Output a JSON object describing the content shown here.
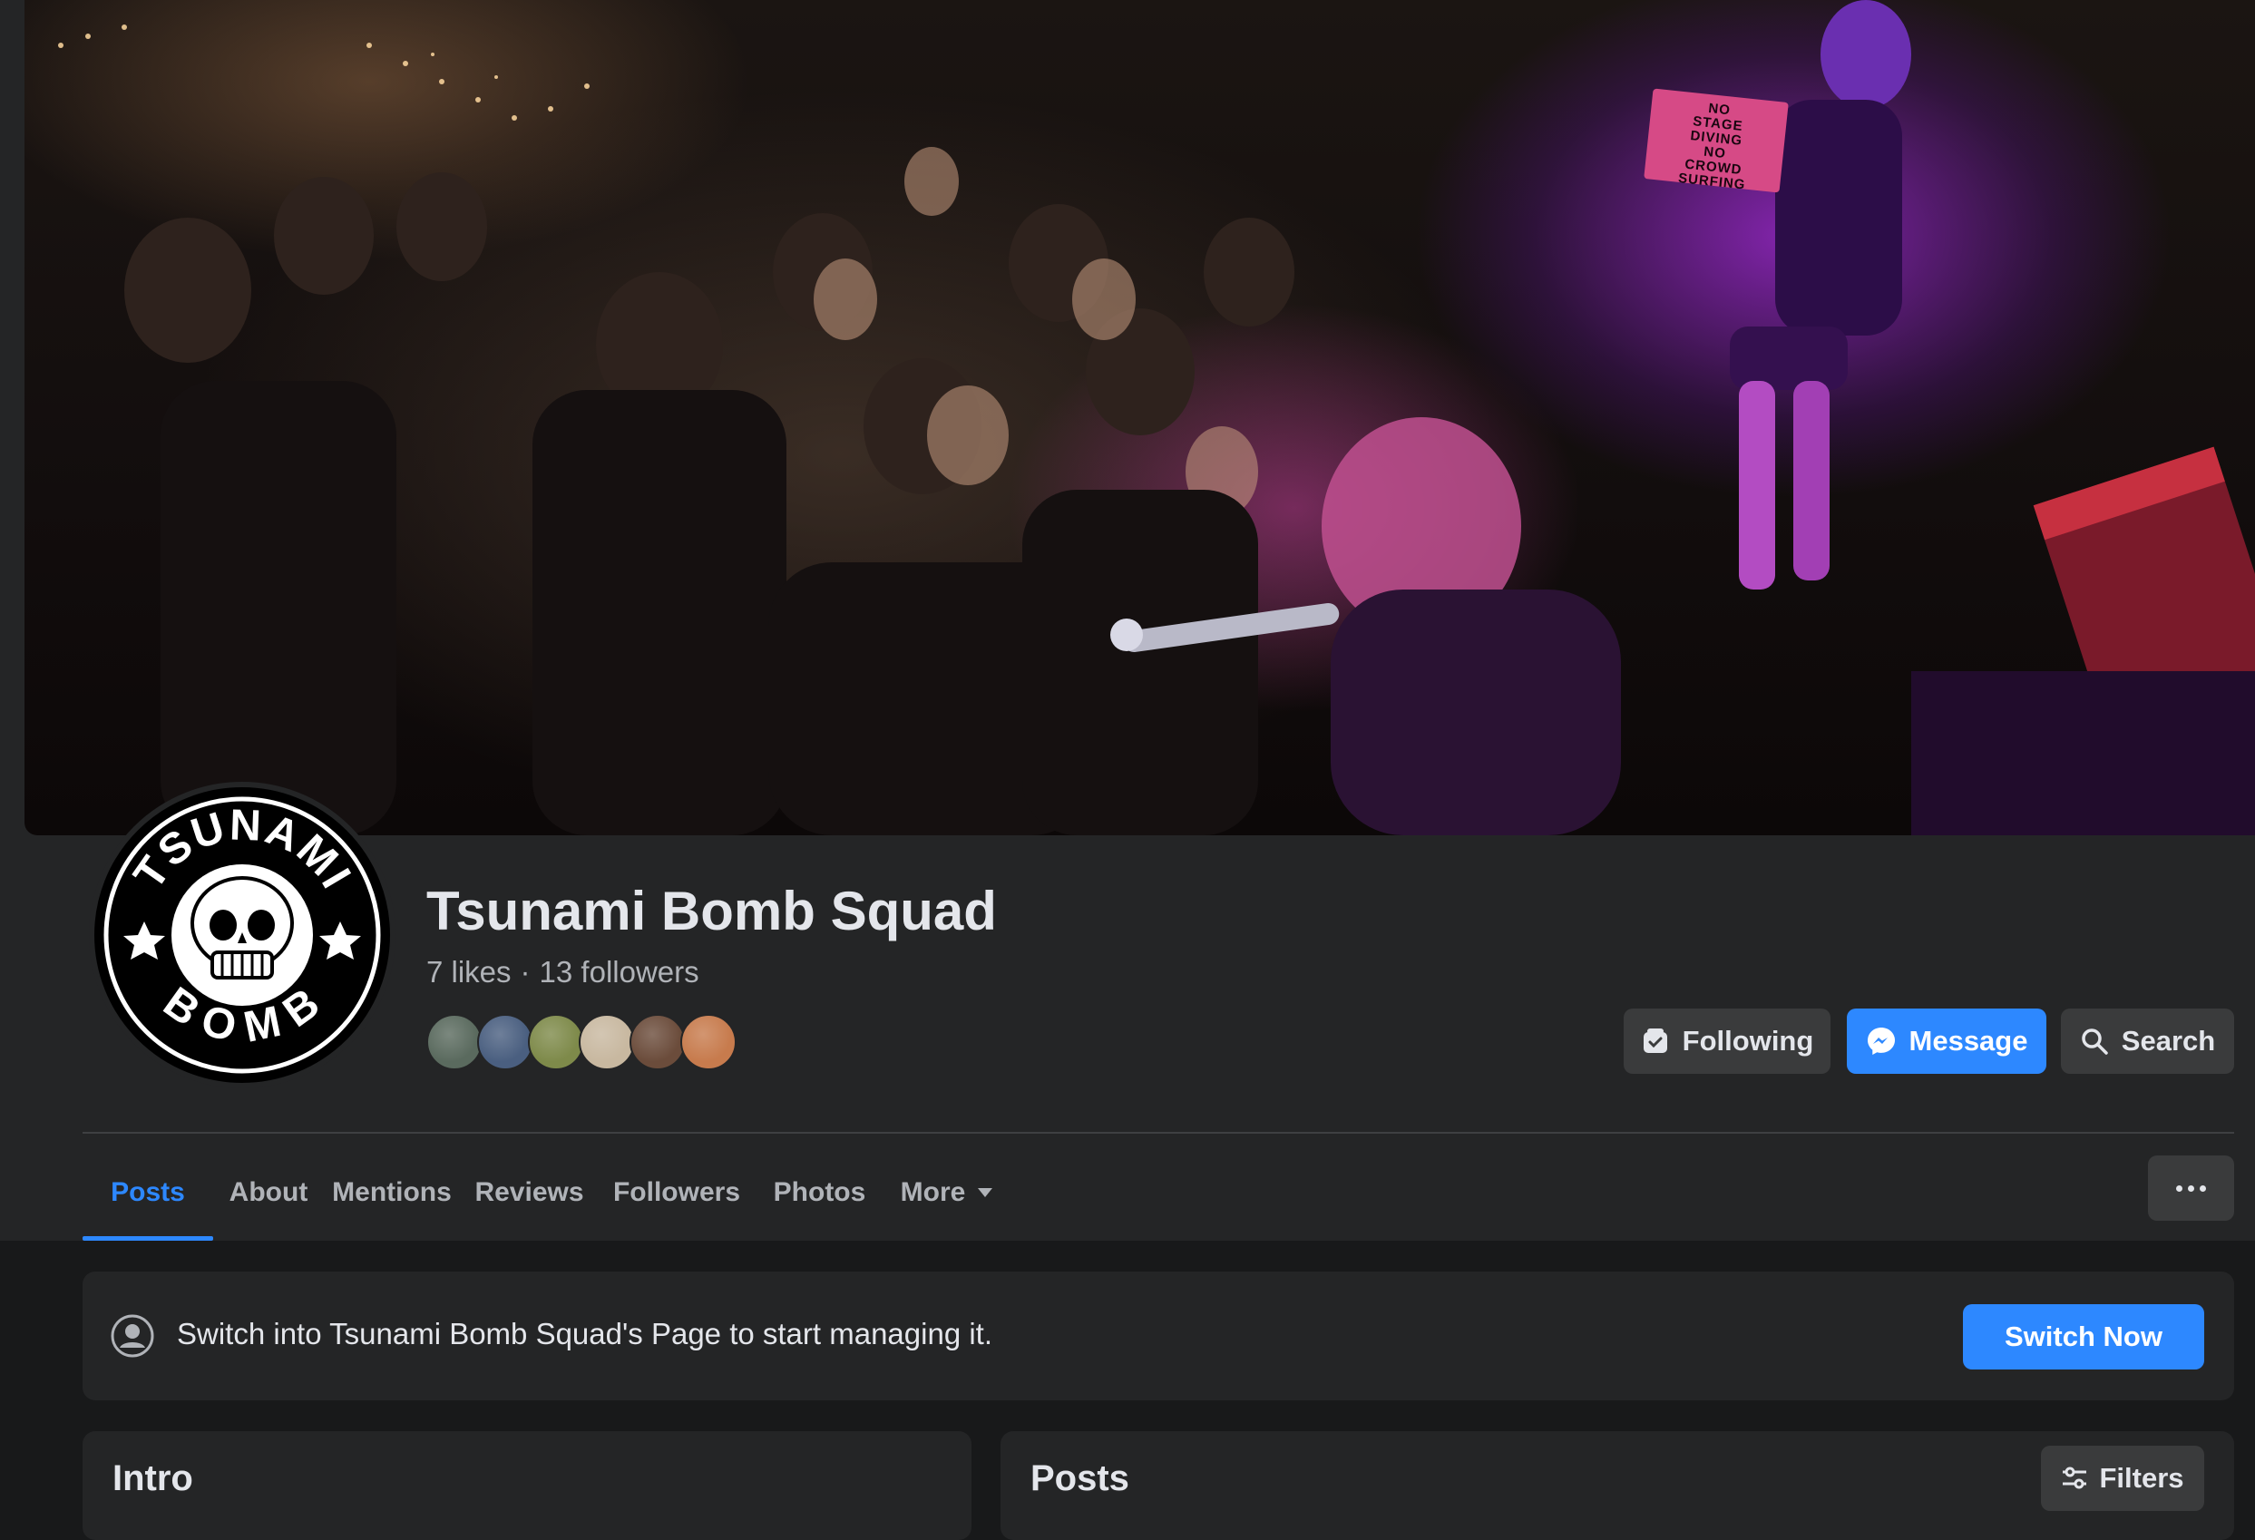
{
  "page": {
    "name": "Tsunami Bomb Squad",
    "likes": "7 likes",
    "separator": "·",
    "followers": "13 followers",
    "avatar_logo_top": "TSUNAMI",
    "avatar_logo_bottom": "BOMB"
  },
  "cover": {
    "sign_lines": [
      "NO",
      "STAGE",
      "DIVING",
      "NO",
      "CROWD",
      "SURFING"
    ]
  },
  "follower_avatars": [
    {
      "color": "#5a6a5e"
    },
    {
      "color": "#4a5f80"
    },
    {
      "color": "#7e8a4a"
    },
    {
      "color": "#c8b8a0"
    },
    {
      "color": "#6b4c3b"
    },
    {
      "color": "#c77b4d"
    }
  ],
  "actions": {
    "following": "Following",
    "message": "Message",
    "search": "Search"
  },
  "tabs": [
    {
      "label": "Posts",
      "active": true
    },
    {
      "label": "About"
    },
    {
      "label": "Mentions"
    },
    {
      "label": "Reviews"
    },
    {
      "label": "Followers"
    },
    {
      "label": "Photos"
    },
    {
      "label": "More"
    }
  ],
  "banner": {
    "text": "Switch into Tsunami Bomb Squad's Page to start managing it.",
    "button": "Switch Now"
  },
  "intro": {
    "title": "Intro"
  },
  "posts": {
    "title": "Posts",
    "filters": "Filters"
  },
  "colors": {
    "accent": "#2d88ff",
    "panel": "#242526",
    "background": "#18191a",
    "button": "#3a3b3c",
    "text_primary": "#e4e6eb",
    "text_secondary": "#b0b3b8"
  }
}
